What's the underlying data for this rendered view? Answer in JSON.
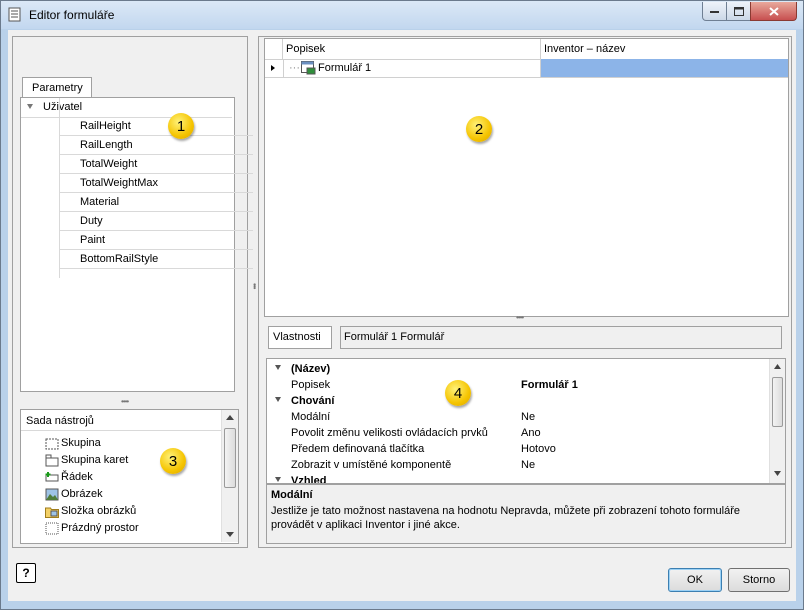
{
  "window": {
    "title": "Editor formuláře"
  },
  "left": {
    "tab_label": "Parametry",
    "group_label": "Uživatel",
    "parameters": [
      "RailHeight",
      "RailLength",
      "TotalWeight",
      "TotalWeightMax",
      "Material",
      "Duty",
      "Paint",
      "BottomRailStyle"
    ]
  },
  "toolbox": {
    "title": "Sada nástrojů",
    "items": [
      "Skupina",
      "Skupina karet",
      "Řádek",
      "Obrázek",
      "Složka obrázků",
      "Prázdný prostor"
    ]
  },
  "grid": {
    "col1": "Popisek",
    "col2": "Inventor – název",
    "rows": [
      {
        "label": "Formulář 1"
      }
    ]
  },
  "properties": {
    "label": "Vlastnosti",
    "object": "Formulář 1 Formulář",
    "rows": [
      {
        "type": "cat",
        "k": "(Název)",
        "v": ""
      },
      {
        "type": "prop",
        "k": "Popisek",
        "v": "Formulář 1",
        "bold": true
      },
      {
        "type": "cat",
        "k": "Chování",
        "v": ""
      },
      {
        "type": "prop",
        "k": "Modální",
        "v": "Ne"
      },
      {
        "type": "prop",
        "k": "Povolit změnu velikosti ovládacích prvků",
        "v": "Ano"
      },
      {
        "type": "prop",
        "k": "Předem definovaná tlačítka",
        "v": "Hotovo"
      },
      {
        "type": "prop",
        "k": "Zobrazit v umístěné komponentě",
        "v": "Ne"
      },
      {
        "type": "cat",
        "k": "Vzhled",
        "v": ""
      }
    ]
  },
  "description": {
    "title": "Modální",
    "body": "Jestliže je tato možnost nastavena na hodnotu Nepravda, můžete při zobrazení tohoto formuláře provádět v aplikaci Inventor i jiné akce."
  },
  "markers": [
    "1",
    "2",
    "3",
    "4"
  ],
  "buttons": {
    "ok": "OK",
    "cancel": "Storno",
    "help": "?"
  }
}
